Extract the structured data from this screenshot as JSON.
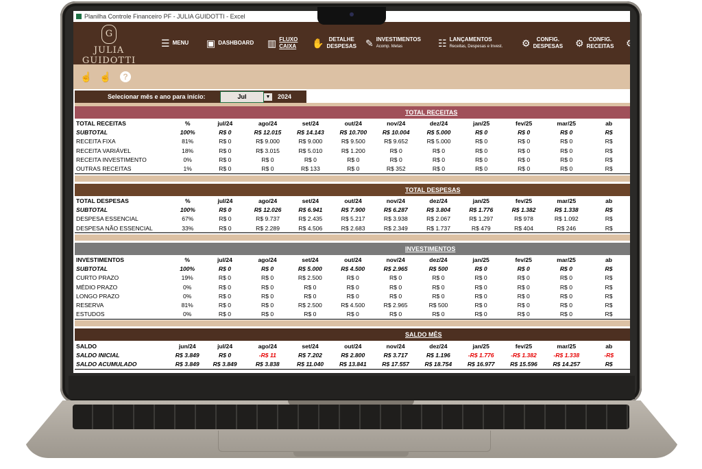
{
  "window": {
    "title": "Planilha Controle Financeiro PF - JULIA GUIDOTTI - Excel"
  },
  "brand": {
    "monogram": "G",
    "name": "JULIA GUIDOTTI"
  },
  "nav": {
    "menu": "MENU",
    "dashboard": "DASHBOARD",
    "fluxo_1": "FLUXO",
    "fluxo_2": "CAIXA",
    "detalhe_1": "DETALHE",
    "detalhe_2": "DESPESAS",
    "investimentos": "INVESTIMENTOS",
    "investimentos_sub": "Acomp. Metas",
    "lancamentos": "LANÇAMENTOS",
    "lancamentos_sub": "Receitas, Despesas e Invest.",
    "config_desp_1": "CONFIG.",
    "config_desp_2": "DESPESAS",
    "config_rec_1": "CONFIG.",
    "config_rec_2": "RECEITAS"
  },
  "icons": {
    "menu": "hamburger-icon",
    "dashboard": "presentation-icon",
    "fluxo": "bar-chart-icon",
    "detalhe": "hand-money-icon",
    "investimentos": "clipboard-icon",
    "lancamentos": "list-icon",
    "config": "gear-icon"
  },
  "selector": {
    "label": "Selecionar mês e ano para início:",
    "month": "Jul",
    "year": "2024"
  },
  "colors": {
    "brown": "#4d3021",
    "tan": "#dcc1a4",
    "receitas": "#a0505a",
    "despesas": "#6b4429",
    "investimentos": "#7a7a7a",
    "negative": "#e60000"
  },
  "receitas": {
    "section": "TOTAL RECEITAS",
    "header": [
      "TOTAL RECEITAS",
      "%",
      "jul/24",
      "ago/24",
      "set/24",
      "out/24",
      "nov/24",
      "dez/24",
      "jan/25",
      "fev/25",
      "mar/25",
      "ab"
    ],
    "rows": [
      [
        "SUBTOTAL",
        "100%",
        "R$ 0",
        "R$ 12.015",
        "R$ 14.143",
        "R$ 10.700",
        "R$ 10.004",
        "R$ 5.000",
        "R$ 0",
        "R$ 0",
        "R$ 0",
        "R$"
      ],
      [
        "RECEITA FIXA",
        "81%",
        "R$ 0",
        "R$ 9.000",
        "R$ 9.000",
        "R$ 9.500",
        "R$ 9.652",
        "R$ 5.000",
        "R$ 0",
        "R$ 0",
        "R$ 0",
        "R$"
      ],
      [
        "RECEITA VARIÁVEL",
        "18%",
        "R$ 0",
        "R$ 3.015",
        "R$ 5.010",
        "R$ 1.200",
        "R$ 0",
        "R$ 0",
        "R$ 0",
        "R$ 0",
        "R$ 0",
        "R$"
      ],
      [
        "RECEITA INVESTIMENTO",
        "0%",
        "R$ 0",
        "R$ 0",
        "R$ 0",
        "R$ 0",
        "R$ 0",
        "R$ 0",
        "R$ 0",
        "R$ 0",
        "R$ 0",
        "R$"
      ],
      [
        "OUTRAS RECEITAS",
        "1%",
        "R$ 0",
        "R$ 0",
        "R$ 133",
        "R$ 0",
        "R$ 352",
        "R$ 0",
        "R$ 0",
        "R$ 0",
        "R$ 0",
        "R$"
      ]
    ]
  },
  "despesas": {
    "section": "TOTAL DESPESAS",
    "header": [
      "TOTAL DESPESAS",
      "%",
      "jul/24",
      "ago/24",
      "set/24",
      "out/24",
      "nov/24",
      "dez/24",
      "jan/25",
      "fev/25",
      "mar/25",
      "ab"
    ],
    "rows": [
      [
        "SUBTOTAL",
        "100%",
        "R$ 0",
        "R$ 12.026",
        "R$ 6.941",
        "R$ 7.900",
        "R$ 6.287",
        "R$ 3.804",
        "R$ 1.776",
        "R$ 1.382",
        "R$ 1.338",
        "R$"
      ],
      [
        "DESPESA ESSENCIAL",
        "67%",
        "R$ 0",
        "R$ 9.737",
        "R$ 2.435",
        "R$ 5.217",
        "R$ 3.938",
        "R$ 2.067",
        "R$ 1.297",
        "R$ 978",
        "R$ 1.092",
        "R$"
      ],
      [
        "DESPESA NÃO ESSENCIAL",
        "33%",
        "R$ 0",
        "R$ 2.289",
        "R$ 4.506",
        "R$ 2.683",
        "R$ 2.349",
        "R$ 1.737",
        "R$ 479",
        "R$ 404",
        "R$ 246",
        "R$"
      ]
    ]
  },
  "investimentos": {
    "section": "INVESTIMENTOS",
    "header": [
      "INVESTIMENTOS",
      "%",
      "jul/24",
      "ago/24",
      "set/24",
      "out/24",
      "nov/24",
      "dez/24",
      "jan/25",
      "fev/25",
      "mar/25",
      "ab"
    ],
    "rows": [
      [
        "SUBTOTAL",
        "100%",
        "R$ 0",
        "R$ 0",
        "R$ 5.000",
        "R$ 4.500",
        "R$ 2.965",
        "R$ 500",
        "R$ 0",
        "R$ 0",
        "R$ 0",
        "R$"
      ],
      [
        "CURTO PRAZO",
        "19%",
        "R$ 0",
        "R$ 0",
        "R$ 2.500",
        "R$ 0",
        "R$ 0",
        "R$ 0",
        "R$ 0",
        "R$ 0",
        "R$ 0",
        "R$"
      ],
      [
        "MÉDIO PRAZO",
        "0%",
        "R$ 0",
        "R$ 0",
        "R$ 0",
        "R$ 0",
        "R$ 0",
        "R$ 0",
        "R$ 0",
        "R$ 0",
        "R$ 0",
        "R$"
      ],
      [
        "LONGO PRAZO",
        "0%",
        "R$ 0",
        "R$ 0",
        "R$ 0",
        "R$ 0",
        "R$ 0",
        "R$ 0",
        "R$ 0",
        "R$ 0",
        "R$ 0",
        "R$"
      ],
      [
        "RESERVA",
        "81%",
        "R$ 0",
        "R$ 0",
        "R$ 2.500",
        "R$ 4.500",
        "R$ 2.965",
        "R$ 500",
        "R$ 0",
        "R$ 0",
        "R$ 0",
        "R$"
      ],
      [
        "ESTUDOS",
        "0%",
        "R$ 0",
        "R$ 0",
        "R$ 0",
        "R$ 0",
        "R$ 0",
        "R$ 0",
        "R$ 0",
        "R$ 0",
        "R$ 0",
        "R$"
      ]
    ]
  },
  "saldo": {
    "section": "SALDO MÊS",
    "header": [
      "SALDO",
      "jun/24",
      "jul/24",
      "ago/24",
      "set/24",
      "out/24",
      "nov/24",
      "dez/24",
      "jan/25",
      "fev/25",
      "mar/25",
      "ab"
    ],
    "rows": [
      [
        "SALDO INICIAL",
        "R$ 3.849",
        "R$ 0",
        "-R$ 11",
        "R$ 7.202",
        "R$ 2.800",
        "R$ 3.717",
        "R$ 1.196",
        "-R$ 1.776",
        "-R$ 1.382",
        "-R$ 1.338",
        "-R$"
      ],
      [
        "SALDO ACUMULADO",
        "R$ 3.849",
        "R$ 3.849",
        "R$ 3.838",
        "R$ 11.040",
        "R$ 13.841",
        "R$ 17.557",
        "R$ 18.754",
        "R$ 16.977",
        "R$ 15.596",
        "R$ 14.257",
        "R$"
      ]
    ]
  }
}
